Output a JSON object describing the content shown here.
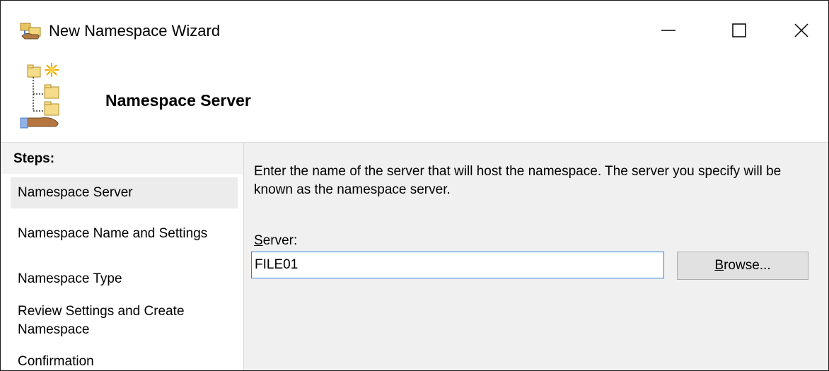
{
  "window": {
    "title": "New Namespace Wizard",
    "icons": {
      "app": "namespace-wizard-icon",
      "header": "namespace-tree-icon"
    }
  },
  "caption_buttons": {
    "minimize": "minimize-icon",
    "maximize": "maximize-icon",
    "close": "close-icon"
  },
  "header": {
    "title": "Namespace Server"
  },
  "steps": {
    "heading": "Steps:",
    "items": [
      {
        "label": "Namespace Server",
        "current": true
      },
      {
        "label": "Namespace Name and Settings",
        "current": false
      },
      {
        "label": "Namespace Type",
        "current": false
      },
      {
        "label": "Review Settings and Create Namespace",
        "current": false
      },
      {
        "label": "Confirmation",
        "current": false
      }
    ]
  },
  "content": {
    "description": "Enter the name of the server that will host the namespace. The server you specify will be known as the namespace server.",
    "server_label_access_key": "S",
    "server_label_rest": "erver:",
    "server_value": "FILE01",
    "browse_access_key": "B",
    "browse_rest": "rowse..."
  },
  "colors": {
    "content_background": "#f0f0f0",
    "current_step_highlight": "#ececec",
    "input_focus_border": "#2c7fd6",
    "button_face": "#e1e1e1"
  }
}
